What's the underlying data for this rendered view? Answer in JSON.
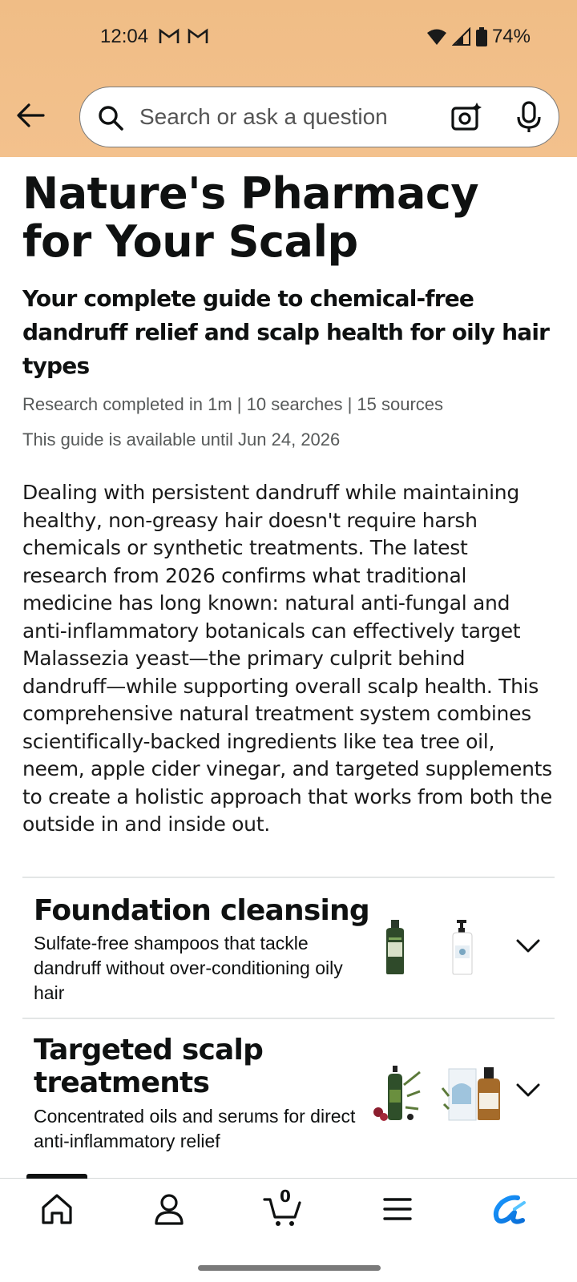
{
  "status_bar": {
    "time": "12:04",
    "battery": "74%"
  },
  "search": {
    "placeholder": "Search or ask a question"
  },
  "article": {
    "title": "Nature's Pharmacy for Your Scalp",
    "subtitle": "Your complete guide to chemical-free dandruff relief and scalp health for oily hair types",
    "research_meta": "Research completed in 1m | 10 searches | 15 sources",
    "availability": "This guide is available until Jun 24, 2026",
    "body": "Dealing with persistent dandruff while maintaining healthy, non-greasy hair doesn't require harsh chemicals or synthetic treatments. The latest research from 2026 confirms what traditional medicine has long known: natural anti-fungal and anti-inflammatory botanicals can effectively target Malassezia yeast—the primary culprit behind dandruff—while supporting overall scalp health. This comprehensive natural treatment system combines scientifically-backed ingredients like tea tree oil, neem, apple cider vinegar, and targeted supplements to create a holistic approach that works from both the outside in and inside out."
  },
  "sections": [
    {
      "title": "Foundation cleansing",
      "description": "Sulfate-free shampoos that tackle dandruff without over-conditioning oily hair"
    },
    {
      "title": "Targeted scalp treatments",
      "description": "Concentrated oils and serums for direct anti-inflammatory relief"
    }
  ],
  "nav": {
    "cart_count": "0",
    "items": [
      "home-icon",
      "account-icon",
      "cart-icon",
      "menu-icon",
      "rufus-icon"
    ]
  },
  "colors": {
    "header_bg": "#f3c18d",
    "accent_blue": "#1a98ff"
  }
}
